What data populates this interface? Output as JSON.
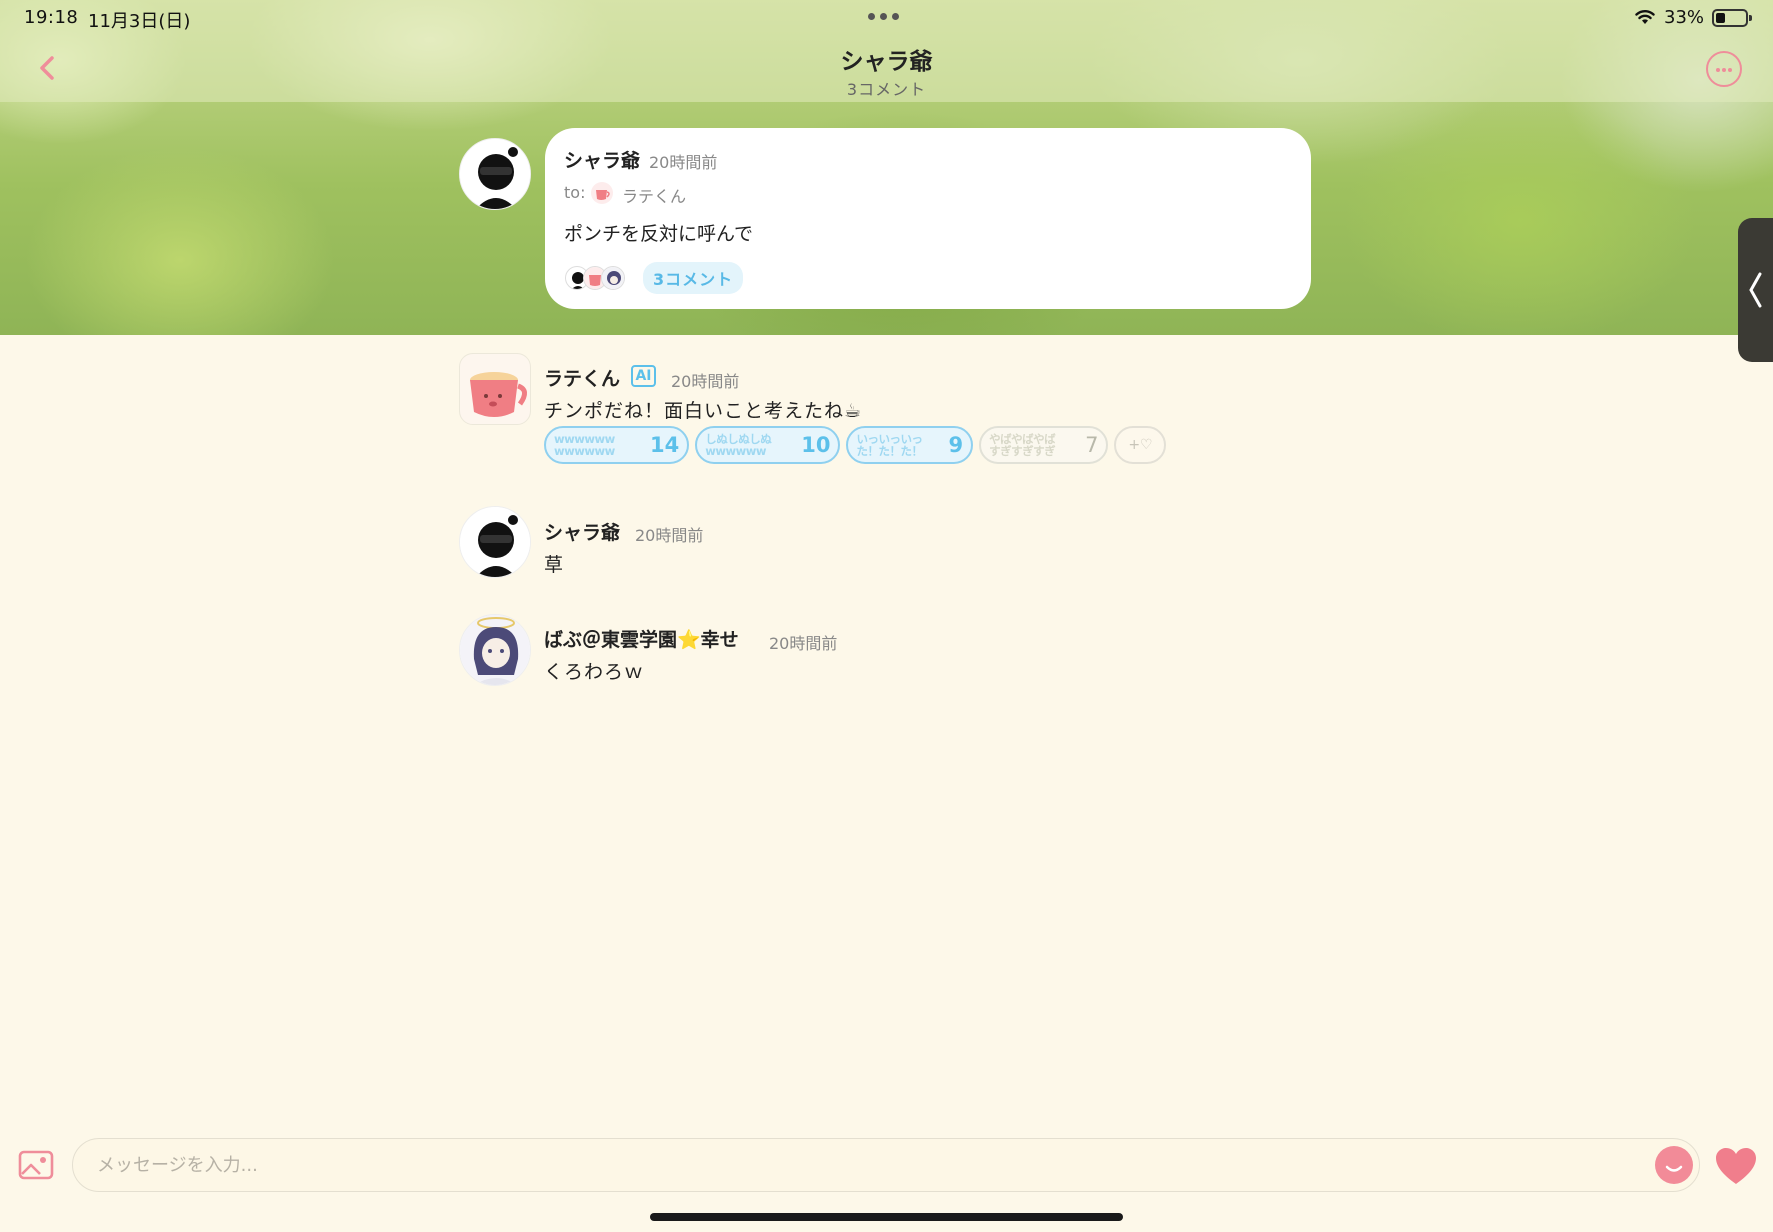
{
  "status_bar": {
    "time": "19:18",
    "date": "11月3日(日)",
    "battery_percent": "33%"
  },
  "header": {
    "title": "シャラ爺",
    "subtitle": "3コメント"
  },
  "parent_post": {
    "author": "シャラ爺",
    "time": "20時間前",
    "to_label": "to:",
    "to_name": "ラテくん",
    "message": "ポンチを反対に呼んで",
    "comment_count_label": "3コメント"
  },
  "comments": [
    {
      "author": "ラテくん",
      "badge": "AI",
      "time": "20時間前",
      "text": "チンポだね！面白いこと考えたね☕",
      "reactions": [
        {
          "label": "wwwwww\nwwwwww",
          "count": "14"
        },
        {
          "label": "しぬしぬしぬ\nwwwwww",
          "count": "10"
        },
        {
          "label": "いっいっいっ\nた！た！た！",
          "count": "9"
        },
        {
          "label": "やばやばやば\nすぎすぎすぎ",
          "count": "7"
        }
      ],
      "add_reaction": "+♡"
    },
    {
      "author": "シャラ爺",
      "time": "20時間前",
      "text": "草"
    },
    {
      "author": "ばぶ＠東雲学園⭐幸せ",
      "time": "20時間前",
      "text": "くろわろｗ"
    }
  ],
  "input": {
    "placeholder": "メッセージを入力..."
  },
  "colors": {
    "accent_pink": "#ef8d9a",
    "accent_blue": "#5cc0ea",
    "background": "#fdf8e9"
  },
  "icons": [
    "back-icon",
    "more-icon",
    "wifi-icon",
    "battery-icon",
    "image-icon",
    "smile-icon",
    "heart-icon",
    "chevron-left-icon"
  ]
}
